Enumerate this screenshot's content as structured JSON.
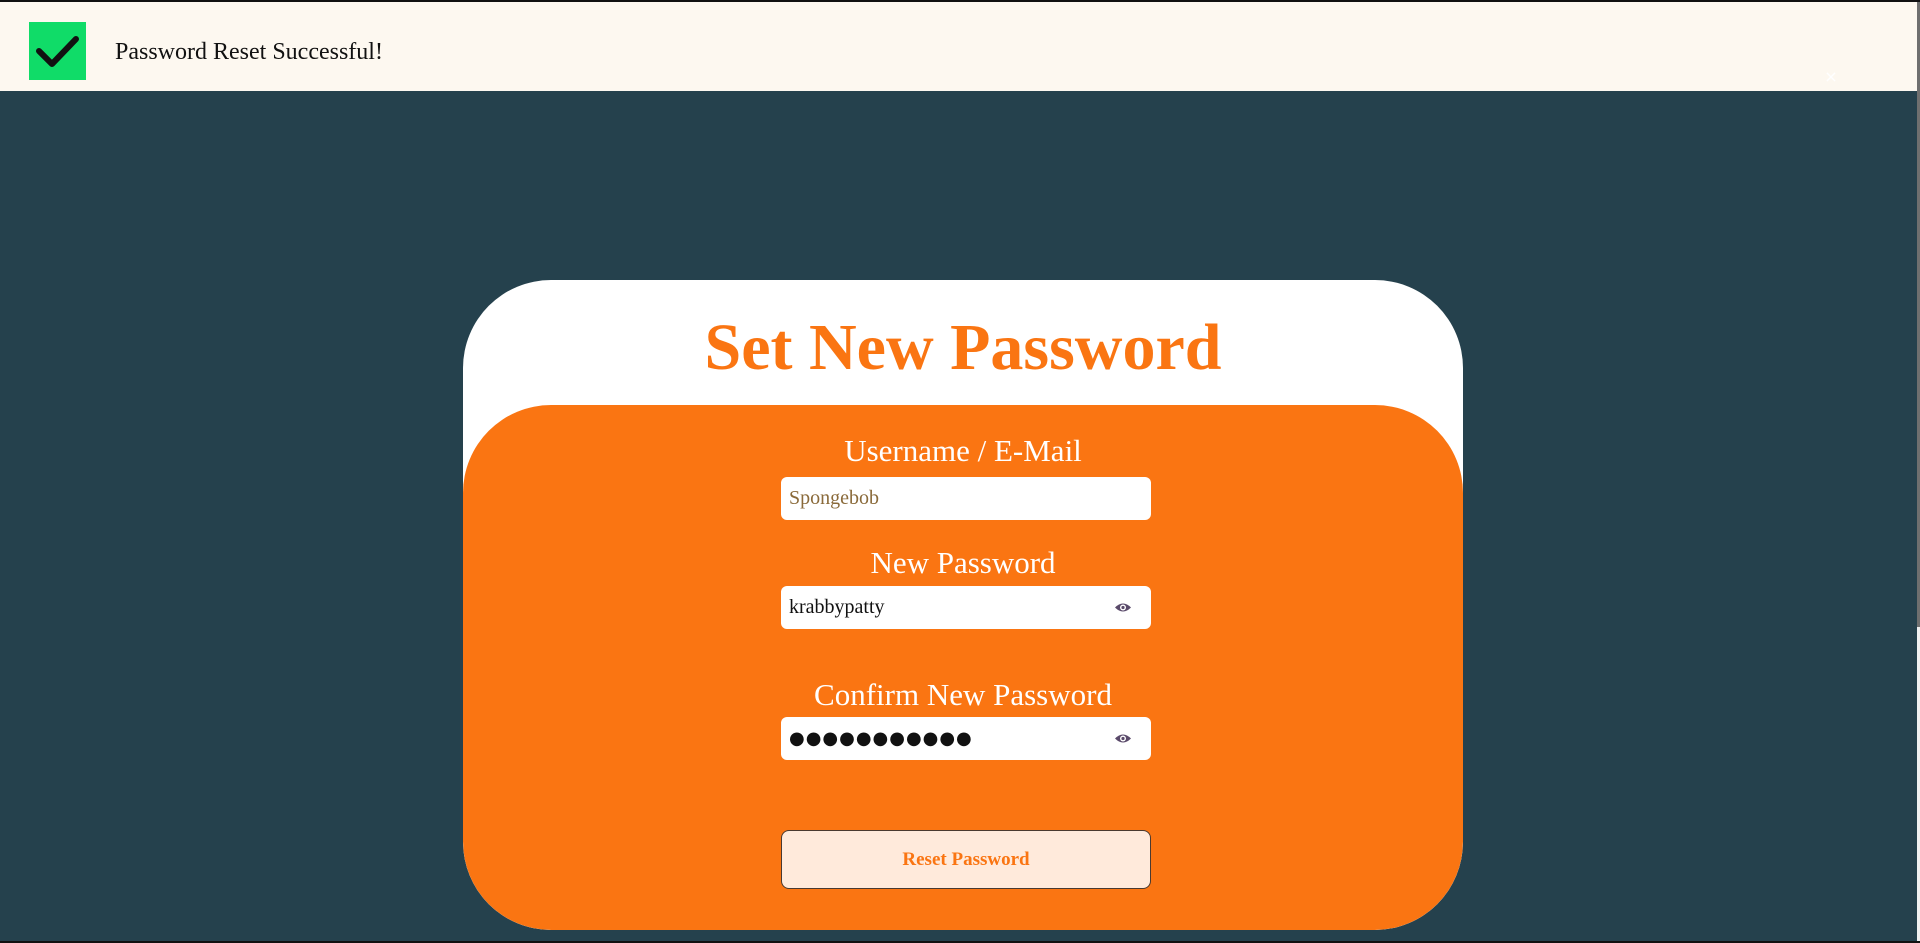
{
  "toast": {
    "message": "Password Reset Successful!",
    "icon": "checkmark-icon",
    "close_icon": "close-icon",
    "close_glyph": "×",
    "accent": "#10dc68"
  },
  "card": {
    "title": "Set New Password",
    "accent": "#fa7512"
  },
  "form": {
    "username": {
      "label": "Username / E-Mail",
      "placeholder": "Spongebob",
      "value": ""
    },
    "new_password": {
      "label": "New Password",
      "value": "krabbypatty",
      "toggle_icon": "eye-icon"
    },
    "confirm_password": {
      "label": "Confirm New Password",
      "masked_value": "●●●●●●●●●●●",
      "toggle_icon": "eye-icon"
    },
    "submit_label": "Reset Password"
  }
}
